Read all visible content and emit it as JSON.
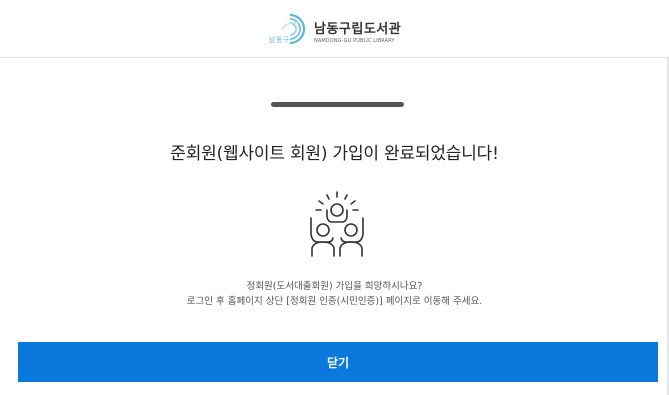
{
  "header": {
    "logo_mark_text": "남동구",
    "library_name": "남동구립도서관",
    "library_name_en": "NAMDONG-GU PUBLIC LIBRARY"
  },
  "main": {
    "title": "준회원(웹사이트 회원) 가입이 완료되었습니다!",
    "desc_line1": "정회원(도서대출회원) 가입을 희망하시나요?",
    "desc_line2": "로그인 후 홈페이지 상단 [정회원 인증(시민인증)] 페이지로 이동해 주세요."
  },
  "actions": {
    "close_label": "닫기"
  },
  "colors": {
    "primary": "#0a78dc",
    "logo_accent": "#5fb4d8"
  }
}
